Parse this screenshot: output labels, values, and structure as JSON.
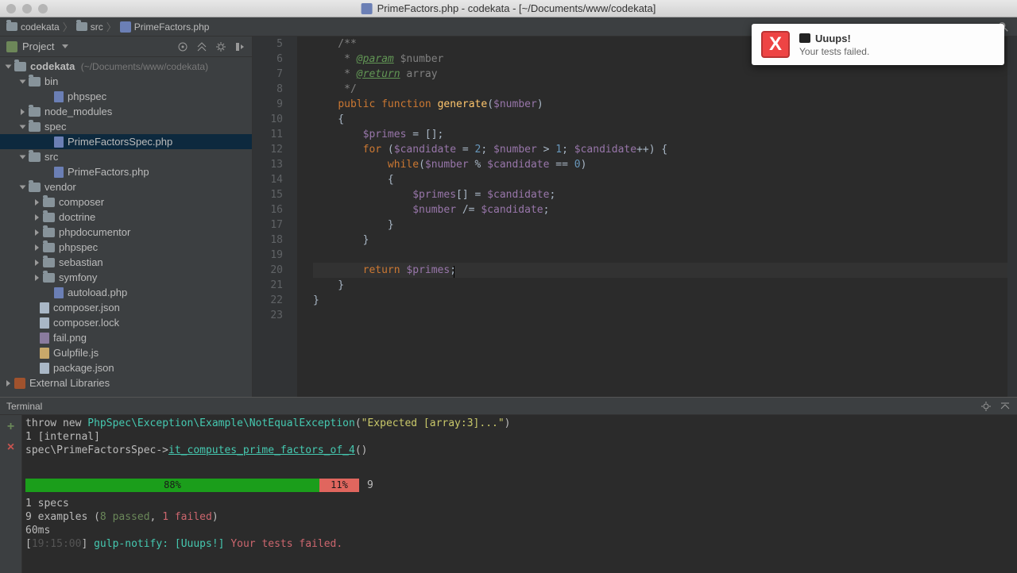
{
  "window": {
    "title": "PrimeFactors.php - codekata - [~/Documents/www/codekata]"
  },
  "breadcrumb": {
    "project": "codekata",
    "dir": "src",
    "file": "PrimeFactors.php"
  },
  "sidebar": {
    "title": "Project",
    "root": {
      "name": "codekata",
      "hint": " (~/Documents/www/codekata)"
    },
    "tree": {
      "bin": "bin",
      "phpspec_bin": "phpspec",
      "node_modules": "node_modules",
      "spec": "spec",
      "primefactorsspec": "PrimeFactorsSpec.php",
      "src": "src",
      "primefactors": "PrimeFactors.php",
      "vendor": "vendor",
      "composer": "composer",
      "doctrine": "doctrine",
      "phpdocumentor": "phpdocumentor",
      "phpspec_v": "phpspec",
      "sebastian": "sebastian",
      "symfony": "symfony",
      "autoload": "autoload.php",
      "composer_json": "composer.json",
      "composer_lock": "composer.lock",
      "fail_png": "fail.png",
      "gulpfile": "Gulpfile.js",
      "package_json": "package.json",
      "ext_lib": "External Libraries"
    }
  },
  "editor": {
    "gutter_start": 5,
    "gutter_end": 23,
    "lines": {
      "l5": "    /**",
      "l6a": "     * ",
      "l6b": "@param",
      "l6c": " $number",
      "l7a": "     * ",
      "l7b": "@return",
      "l7c": " array",
      "l8": "     */",
      "l9_kw1": "public",
      "l9_kw2": "function",
      "l9_fn": "generate",
      "l9_p1": "(",
      "l9_var": "$number",
      "l9_p2": ")",
      "l10": "    {",
      "l11_var": "$primes",
      "l11_rest": " = [];",
      "l12_kw": "for",
      "l12_p1": " (",
      "l12_v1": "$candidate",
      "l12_op1": " = ",
      "l12_n1": "2",
      "l12_s1": "; ",
      "l12_v2": "$number",
      "l12_op2": " > ",
      "l12_n2": "1",
      "l12_s2": "; ",
      "l12_v3": "$candidate",
      "l12_op3": "++) {",
      "l13_kw": "while",
      "l13_p": "(",
      "l13_v1": "$number",
      "l13_op1": " % ",
      "l13_v2": "$candidate",
      "l13_op2": " == ",
      "l13_n": "0",
      "l13_p2": ")",
      "l14": "            {",
      "l15_v1": "$primes",
      "l15_op": "[] = ",
      "l15_v2": "$candidate",
      "l15_s": ";",
      "l16_v1": "$number",
      "l16_op": " /= ",
      "l16_v2": "$candidate",
      "l16_s": ";",
      "l17": "            }",
      "l18": "        }",
      "l19": "",
      "l20_kw": "return",
      "l20_sp": " ",
      "l20_v": "$primes",
      "l20_s": ";",
      "l21": "    }",
      "l22": "}",
      "l23": ""
    }
  },
  "terminal": {
    "title": "Terminal",
    "lines": {
      "l1a": "        throw new ",
      "l1b": "PhpSpec\\Exception\\Example\\NotEqualException",
      "l1c": "(",
      "l1d": "\"Expected [array:3]...\"",
      "l1e": ")",
      "l2": "    1 [internal]",
      "l3a": "      spec\\PrimeFactorsSpec->",
      "l3b": "it_computes_prime_factors_of_4",
      "l3c": "()"
    },
    "progress": {
      "pass_pct": "88%",
      "fail_pct": "11%",
      "total": "9"
    },
    "summary": {
      "specs": "1 specs",
      "examples_a": "9 examples (",
      "examples_pass": "8 passed",
      "examples_sep": ", ",
      "examples_fail": "1 failed",
      "examples_end": ")",
      "time": "60ms",
      "ts_a": "[",
      "ts": "19:15:00",
      "ts_b": "] ",
      "notify_a": "gulp-notify: [",
      "notify_b": "Uuups!",
      "notify_c": "] ",
      "notify_msg": "Your tests failed."
    }
  },
  "notification": {
    "title": "Uuups!",
    "message": "Your tests failed."
  }
}
